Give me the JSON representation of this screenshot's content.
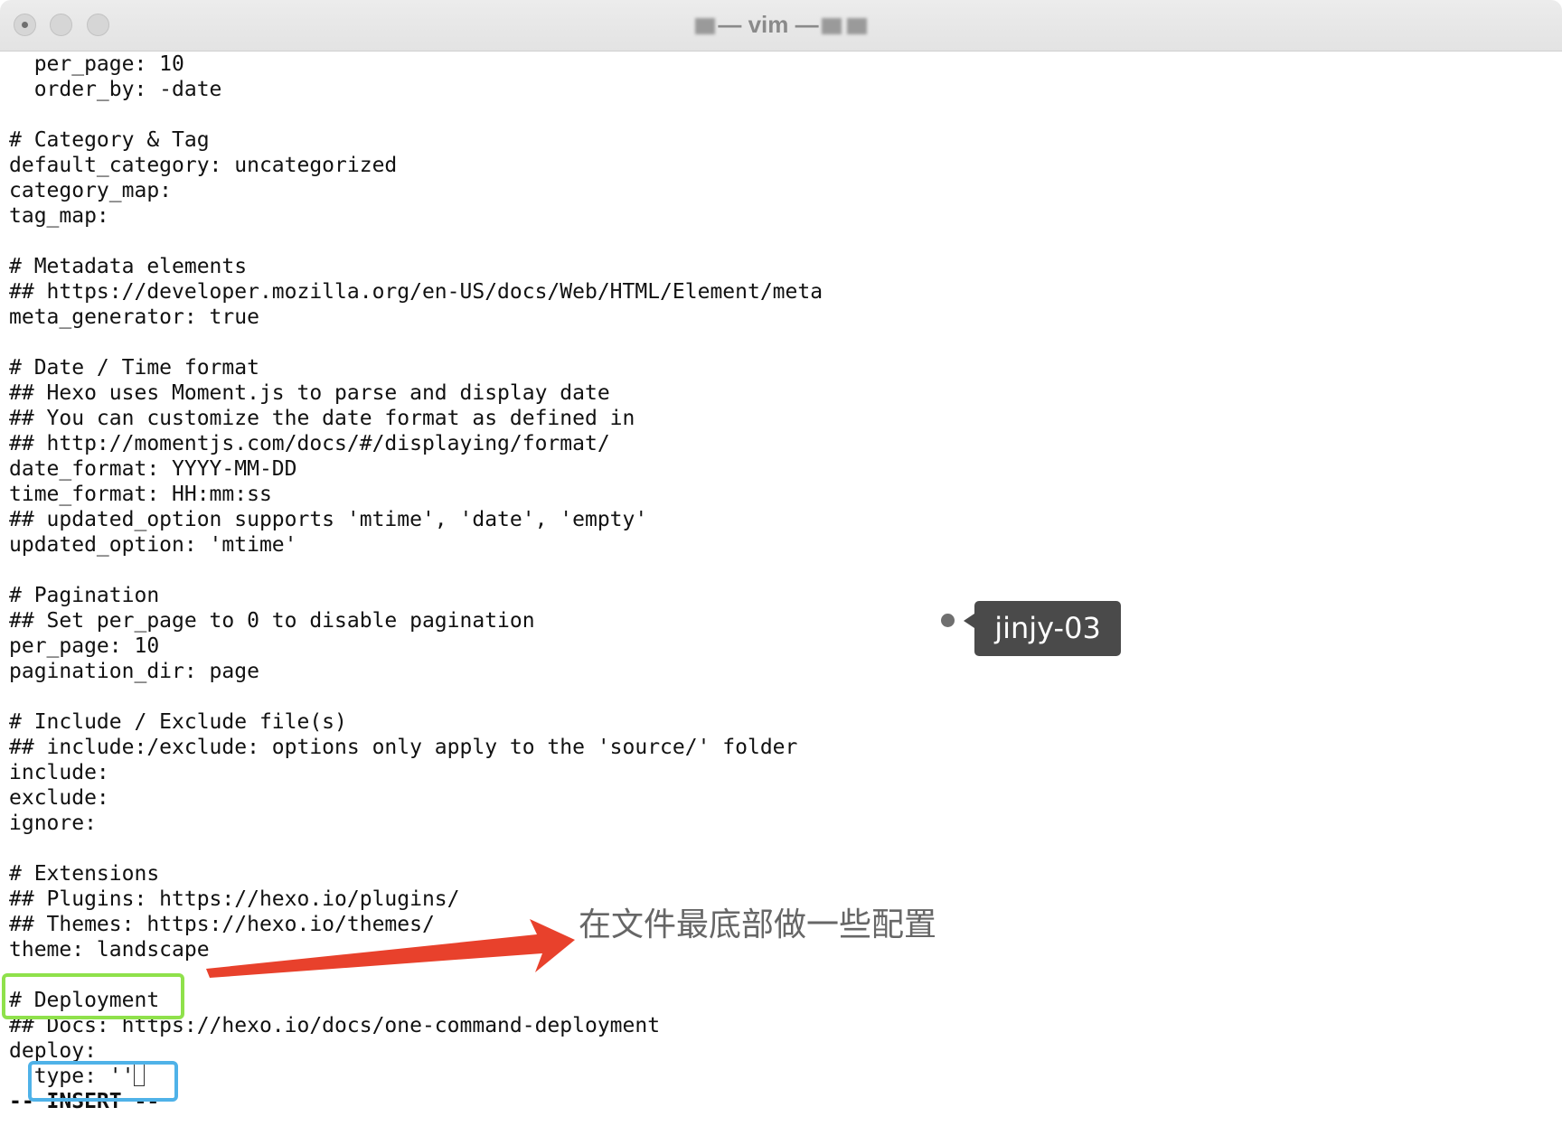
{
  "window": {
    "title_text": "— vim —"
  },
  "editor": {
    "lines": [
      "  per_page: 10",
      "  order_by: -date",
      "",
      "# Category & Tag",
      "default_category: uncategorized",
      "category_map:",
      "tag_map:",
      "",
      "# Metadata elements",
      "## https://developer.mozilla.org/en-US/docs/Web/HTML/Element/meta",
      "meta_generator: true",
      "",
      "# Date / Time format",
      "## Hexo uses Moment.js to parse and display date",
      "## You can customize the date format as defined in",
      "## http://momentjs.com/docs/#/displaying/format/",
      "date_format: YYYY-MM-DD",
      "time_format: HH:mm:ss",
      "## updated_option supports 'mtime', 'date', 'empty'",
      "updated_option: 'mtime'",
      "",
      "# Pagination",
      "## Set per_page to 0 to disable pagination",
      "per_page: 10",
      "pagination_dir: page",
      "",
      "# Include / Exclude file(s)",
      "## include:/exclude: options only apply to the 'source/' folder",
      "include:",
      "exclude:",
      "ignore:",
      "",
      "# Extensions",
      "## Plugins: https://hexo.io/plugins/",
      "## Themes: https://hexo.io/themes/",
      "theme: landscape",
      "",
      "# Deployment",
      "## Docs: https://hexo.io/docs/one-command-deployment",
      "deploy:",
      "  type: ''"
    ],
    "mode_line": "-- INSERT --"
  },
  "annotations": {
    "note_text": "在文件最底部做一些配置",
    "arrow_color": "#e8412c",
    "green_box_color": "#8fe14b",
    "blue_box_color": "#4fb2e8",
    "tag_label": "jinjy-03"
  }
}
